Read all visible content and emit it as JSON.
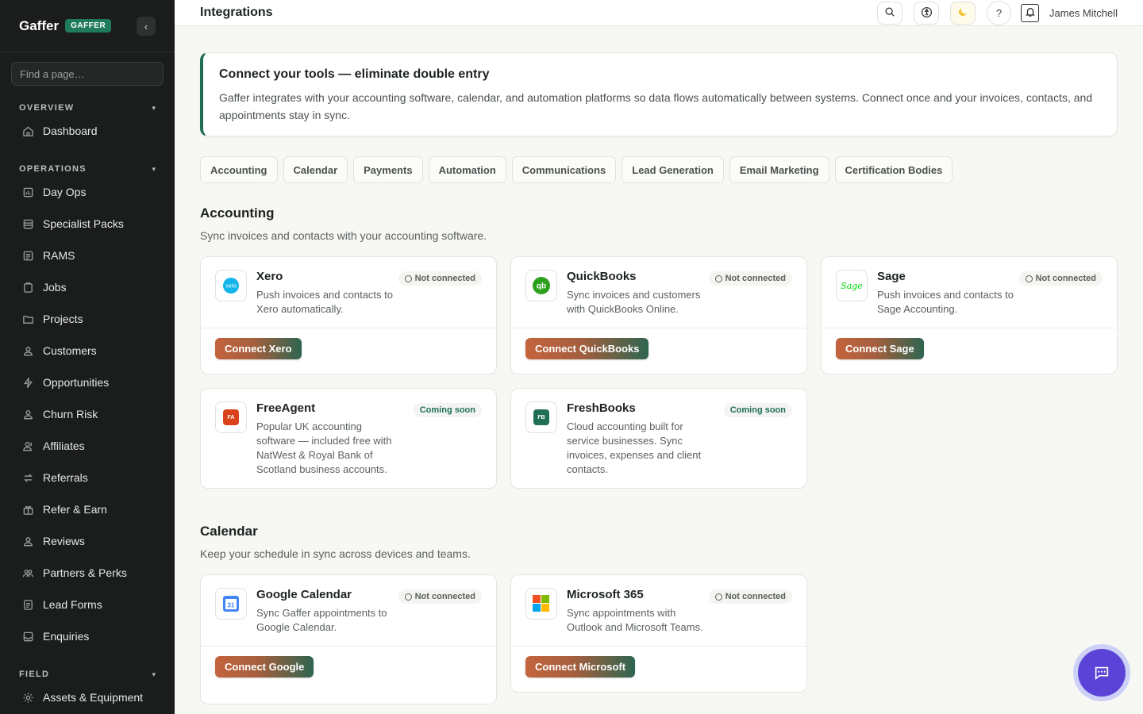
{
  "sidebar": {
    "brand": "Gaffer",
    "badge": "GAFFER",
    "collapse_icon": "chevron-left-icon",
    "search_placeholder": "Find a page…",
    "sections": {
      "overview": "OVERVIEW",
      "operations": "OPERATIONS",
      "field": "FIELD"
    },
    "items": {
      "dashboard": "Dashboard",
      "day_ops": "Day Ops",
      "specialist_packs": "Specialist Packs",
      "rams": "RAMS",
      "jobs": "Jobs",
      "projects": "Projects",
      "customers": "Customers",
      "opportunities": "Opportunities",
      "churn_risk": "Churn Risk",
      "affiliates": "Affiliates",
      "referrals": "Referrals",
      "refer_earn": "Refer & Earn",
      "reviews": "Reviews",
      "partners_perks": "Partners & Perks",
      "lead_forms": "Lead Forms",
      "enquiries": "Enquiries",
      "assets_equipment": "Assets & Equipment"
    }
  },
  "topbar": {
    "title": "Integrations",
    "user": "James Mitchell",
    "help": "?"
  },
  "banner": {
    "title": "Connect your tools — eliminate double entry",
    "text": "Gaffer integrates with your accounting software, calendar, and automation platforms so data flows automatically between systems. Connect once and your invoices, contacts, and appointments stay in sync."
  },
  "tabs": [
    "Accounting",
    "Calendar",
    "Payments",
    "Automation",
    "Communications",
    "Lead Generation",
    "Email Marketing",
    "Certification Bodies"
  ],
  "accounting": {
    "title": "Accounting",
    "desc": "Sync invoices and contacts with your accounting software.",
    "cards": {
      "xero": {
        "name": "Xero",
        "desc": "Push invoices and contacts to Xero automatically.",
        "status": "Not connected",
        "button": "Connect Xero",
        "logo_text": "xero"
      },
      "quickbooks": {
        "name": "QuickBooks",
        "desc": "Sync invoices and customers with QuickBooks Online.",
        "status": "Not connected",
        "button": "Connect QuickBooks",
        "logo_text": "qb"
      },
      "sage": {
        "name": "Sage",
        "desc": "Push invoices and contacts to Sage Accounting.",
        "status": "Not connected",
        "button": "Connect Sage",
        "logo_text": "Sage"
      },
      "freeagent": {
        "name": "FreeAgent",
        "desc": "Popular UK accounting software — included free with NatWest & Royal Bank of Scotland business accounts.",
        "status": "Coming soon",
        "logo_text": "FA"
      },
      "freshbooks": {
        "name": "FreshBooks",
        "desc": "Cloud accounting built for service businesses. Sync invoices, expenses and client contacts.",
        "status": "Coming soon",
        "logo_text": "FB"
      }
    }
  },
  "calendar": {
    "title": "Calendar",
    "desc": "Keep your schedule in sync across devices and teams.",
    "cards": {
      "google": {
        "name": "Google Calendar",
        "desc": "Sync Gaffer appointments to Google Calendar.",
        "status": "Not connected",
        "button": "Connect Google",
        "logo_text": "31"
      },
      "microsoft": {
        "name": "Microsoft 365",
        "desc": "Sync appointments with Outlook and Microsoft Teams.",
        "status": "Not connected",
        "button": "Connect Microsoft"
      }
    }
  },
  "colors": {
    "sidebar_bg": "#1a1d1c",
    "accent_green": "#1f6e55",
    "badge_green": "#1f7a5c",
    "button_gradient_start": "#c4643d",
    "button_gradient_end": "#2e6550",
    "chat_fab": "#5a43d6"
  }
}
